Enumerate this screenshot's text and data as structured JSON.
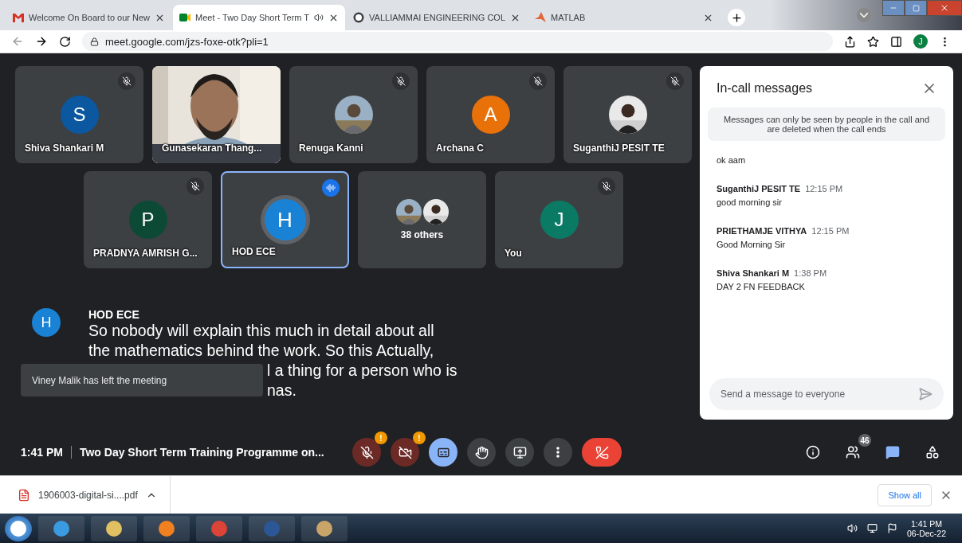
{
  "browser": {
    "tabs": [
      {
        "label": "Welcome On Board to our New",
        "kind": "mail",
        "selected": false,
        "audio": false
      },
      {
        "label": "Meet - Two Day Short Term T",
        "kind": "meet",
        "selected": true,
        "audio": true
      },
      {
        "label": "VALLIAMMAI ENGINEERING COL",
        "kind": "wp",
        "selected": false,
        "audio": false
      },
      {
        "label": "MATLAB",
        "kind": "matlab",
        "selected": false,
        "audio": false
      }
    ],
    "url": "meet.google.com/jzs-foxe-otk?pli=1",
    "profile": "J"
  },
  "tiles": [
    [
      {
        "name": "Shiva Shankari M",
        "kind": "letter",
        "letter": "S",
        "color": "#0b57a0",
        "muted": true,
        "speaking": false
      },
      {
        "name": "Gunasekaran Thang...",
        "kind": "video",
        "muted": false,
        "speaking": false
      },
      {
        "name": "Renuga Kanni",
        "muted": true,
        "speaking": false
      },
      {
        "name": "Archana C",
        "kind": "letter",
        "letter": "A",
        "color": "#e8710a",
        "muted": true,
        "speaking": false
      },
      {
        "name": "SuganthiJ PESIT TE",
        "muted": true,
        "speaking": false
      }
    ],
    [
      {
        "name": "PRADNYA AMRISH G...",
        "kind": "letter",
        "letter": "P",
        "color": "#0d4a35",
        "muted": true,
        "speaking": false
      },
      {
        "name": "HOD ECE",
        "kind": "letter",
        "letter": "H",
        "color": "#1a82d4",
        "muted": false,
        "speaking": true
      },
      {
        "name": "38 others",
        "kind": "group",
        "muted": false,
        "speaking": false
      },
      {
        "name": "You",
        "kind": "letter",
        "letter": "J",
        "color": "#0b7a65",
        "muted": true,
        "speaking": false
      }
    ]
  ],
  "caption": {
    "letter": "H",
    "speaker": "HOD ECE",
    "lines": [
      {
        "text": "So nobody will explain this much in detail about all",
        "kind": "full"
      },
      {
        "text": "the mathematics behind the work. So this Actually,",
        "kind": "full"
      },
      {
        "text": "l a thing for a person who is",
        "kind": "partial"
      },
      {
        "text": "nas.",
        "kind": "partial"
      }
    ]
  },
  "toast": "Viney Malik has left the meeting",
  "meeting": {
    "time": "1:41 PM",
    "title": "Two Day Short Term Training Programme on..."
  },
  "controls": [
    {
      "kind": "mic",
      "badge": "!",
      "selected": false
    },
    {
      "kind": "cam",
      "badge": "!",
      "selected": false
    },
    {
      "kind": "cc",
      "selected": true
    },
    {
      "kind": "hand",
      "selected": false
    },
    {
      "kind": "present",
      "selected": false
    },
    {
      "kind": "more",
      "selected": false
    },
    {
      "kind": "end",
      "selected": false
    }
  ],
  "side_controls": [
    {
      "kind": "info",
      "selected": false
    },
    {
      "kind": "people",
      "badge": "46",
      "selected": false
    },
    {
      "kind": "chat",
      "selected": true
    },
    {
      "kind": "activities",
      "selected": false
    }
  ],
  "chat": {
    "title": "In-call messages",
    "notice": "Messages can only be seen by people in the call and are deleted when the call ends",
    "messages": [
      {
        "text": "ok  aam"
      },
      {
        "sender": "SuganthiJ PESIT TE",
        "time": "12:15 PM",
        "text": "good morning sir"
      },
      {
        "sender": "PRIETHAMJE VITHYA",
        "time": "12:15 PM",
        "text": "Good Morning Sir"
      },
      {
        "sender": "Shiva Shankari M",
        "time": "1:38 PM",
        "text": "DAY 2 FN FEEDBACK"
      }
    ],
    "placeholder": "Send a message to everyone"
  },
  "download": {
    "file": "1906003-digital-si....pdf",
    "show_all": "Show all"
  },
  "taskbar": {
    "apps": [
      {
        "kind": "start"
      },
      {
        "kind": "ie"
      },
      {
        "kind": "explorer"
      },
      {
        "kind": "media"
      },
      {
        "kind": "chrome"
      },
      {
        "kind": "word"
      },
      {
        "kind": "paint"
      }
    ],
    "time": "1:41 PM",
    "date": "06-Dec-22"
  }
}
